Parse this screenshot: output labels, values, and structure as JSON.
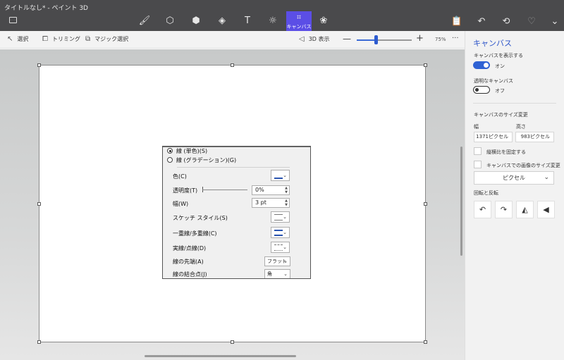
{
  "window": {
    "title": "タイトルなし* - ペイント 3D"
  },
  "tools": [
    {
      "name": "brushes-icon",
      "glyph": "🖌"
    },
    {
      "name": "2d-shapes-icon",
      "glyph": "⬡"
    },
    {
      "name": "3d-shapes-icon",
      "glyph": "⬢"
    },
    {
      "name": "stickers-icon",
      "glyph": "◈"
    },
    {
      "name": "text-icon",
      "glyph": "T"
    },
    {
      "name": "effects-icon",
      "glyph": "☼"
    }
  ],
  "canvas_tool": {
    "label": "キャンバス",
    "glyph": "⌗"
  },
  "library_glyph": "❀",
  "window_tools": {
    "paste": "📋",
    "undo": "↶",
    "history": "⟲",
    "redo": "♡",
    "expand": "⌄"
  },
  "toolbar": {
    "select_label": "選択",
    "select_icon": "↖",
    "crop_label": "トリミング",
    "crop_icon": "⧠",
    "magic_label": "マジック選択",
    "magic_icon": "⧉",
    "view3d_label": "3D 表示",
    "view3d_icon": "◁",
    "zoom_minus": "—",
    "zoom_plus": "+",
    "zoom_percent": "75%",
    "zoom_value": 0.35,
    "more": "···"
  },
  "dialog": {
    "solid_line": "線 (単色)(S)",
    "gradient_line": "線 (グラデーション)(G)",
    "color": "色(C)",
    "transparency": "透明度(T)",
    "transparency_value": "0%",
    "width": "幅(W)",
    "width_value": "3 pt",
    "sketch_style": "スケッチ スタイル(S)",
    "compound": "一重線/多重線(C)",
    "dash": "実線/点線(D)",
    "cap": "線の先端(A)",
    "cap_value": "フラット",
    "join": "線の結合点(J)",
    "join_value": "角",
    "caret": "⌄",
    "up": "▲",
    "down": "▼"
  },
  "panel": {
    "title": "キャンバス",
    "show_canvas_label": "キャンバスを表示する",
    "show_canvas_state": "オン",
    "transparent_label": "透明なキャンバス",
    "transparent_state": "オフ",
    "resize_label": "キャンバスのサイズ変更",
    "width_label": "幅",
    "height_label": "高さ",
    "width_value": "1371ピクセル",
    "height_value": "983ピクセル",
    "lock_ratio_label": "縦横比を固定する",
    "resize_image_label": "キャンバスでの画像のサイズ変更",
    "unit_value": "ピクセル",
    "unit_caret": "⌄",
    "rotate_label": "回転と反転",
    "rotate_left": "↶",
    "rotate_right": "↷",
    "flip_v": "◭",
    "flip_h": "◀"
  }
}
